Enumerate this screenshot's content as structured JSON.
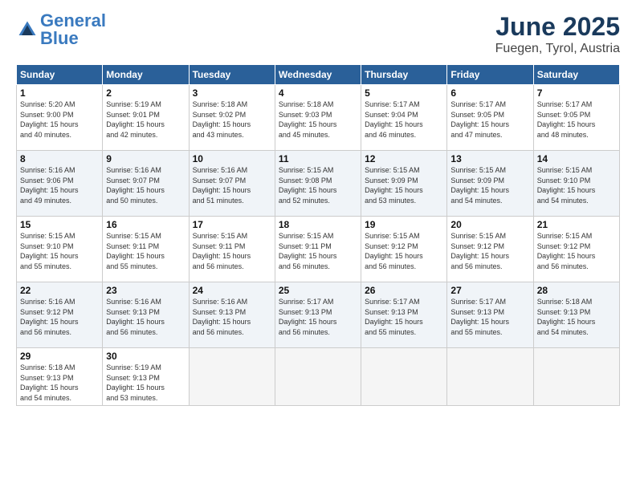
{
  "header": {
    "logo_general": "General",
    "logo_blue": "Blue",
    "month": "June 2025",
    "location": "Fuegen, Tyrol, Austria"
  },
  "weekdays": [
    "Sunday",
    "Monday",
    "Tuesday",
    "Wednesday",
    "Thursday",
    "Friday",
    "Saturday"
  ],
  "weeks": [
    [
      {
        "day": "1",
        "info": "Sunrise: 5:20 AM\nSunset: 9:00 PM\nDaylight: 15 hours\nand 40 minutes."
      },
      {
        "day": "2",
        "info": "Sunrise: 5:19 AM\nSunset: 9:01 PM\nDaylight: 15 hours\nand 42 minutes."
      },
      {
        "day": "3",
        "info": "Sunrise: 5:18 AM\nSunset: 9:02 PM\nDaylight: 15 hours\nand 43 minutes."
      },
      {
        "day": "4",
        "info": "Sunrise: 5:18 AM\nSunset: 9:03 PM\nDaylight: 15 hours\nand 45 minutes."
      },
      {
        "day": "5",
        "info": "Sunrise: 5:17 AM\nSunset: 9:04 PM\nDaylight: 15 hours\nand 46 minutes."
      },
      {
        "day": "6",
        "info": "Sunrise: 5:17 AM\nSunset: 9:05 PM\nDaylight: 15 hours\nand 47 minutes."
      },
      {
        "day": "7",
        "info": "Sunrise: 5:17 AM\nSunset: 9:05 PM\nDaylight: 15 hours\nand 48 minutes."
      }
    ],
    [
      {
        "day": "8",
        "info": "Sunrise: 5:16 AM\nSunset: 9:06 PM\nDaylight: 15 hours\nand 49 minutes."
      },
      {
        "day": "9",
        "info": "Sunrise: 5:16 AM\nSunset: 9:07 PM\nDaylight: 15 hours\nand 50 minutes."
      },
      {
        "day": "10",
        "info": "Sunrise: 5:16 AM\nSunset: 9:07 PM\nDaylight: 15 hours\nand 51 minutes."
      },
      {
        "day": "11",
        "info": "Sunrise: 5:15 AM\nSunset: 9:08 PM\nDaylight: 15 hours\nand 52 minutes."
      },
      {
        "day": "12",
        "info": "Sunrise: 5:15 AM\nSunset: 9:09 PM\nDaylight: 15 hours\nand 53 minutes."
      },
      {
        "day": "13",
        "info": "Sunrise: 5:15 AM\nSunset: 9:09 PM\nDaylight: 15 hours\nand 54 minutes."
      },
      {
        "day": "14",
        "info": "Sunrise: 5:15 AM\nSunset: 9:10 PM\nDaylight: 15 hours\nand 54 minutes."
      }
    ],
    [
      {
        "day": "15",
        "info": "Sunrise: 5:15 AM\nSunset: 9:10 PM\nDaylight: 15 hours\nand 55 minutes."
      },
      {
        "day": "16",
        "info": "Sunrise: 5:15 AM\nSunset: 9:11 PM\nDaylight: 15 hours\nand 55 minutes."
      },
      {
        "day": "17",
        "info": "Sunrise: 5:15 AM\nSunset: 9:11 PM\nDaylight: 15 hours\nand 56 minutes."
      },
      {
        "day": "18",
        "info": "Sunrise: 5:15 AM\nSunset: 9:11 PM\nDaylight: 15 hours\nand 56 minutes."
      },
      {
        "day": "19",
        "info": "Sunrise: 5:15 AM\nSunset: 9:12 PM\nDaylight: 15 hours\nand 56 minutes."
      },
      {
        "day": "20",
        "info": "Sunrise: 5:15 AM\nSunset: 9:12 PM\nDaylight: 15 hours\nand 56 minutes."
      },
      {
        "day": "21",
        "info": "Sunrise: 5:15 AM\nSunset: 9:12 PM\nDaylight: 15 hours\nand 56 minutes."
      }
    ],
    [
      {
        "day": "22",
        "info": "Sunrise: 5:16 AM\nSunset: 9:12 PM\nDaylight: 15 hours\nand 56 minutes."
      },
      {
        "day": "23",
        "info": "Sunrise: 5:16 AM\nSunset: 9:13 PM\nDaylight: 15 hours\nand 56 minutes."
      },
      {
        "day": "24",
        "info": "Sunrise: 5:16 AM\nSunset: 9:13 PM\nDaylight: 15 hours\nand 56 minutes."
      },
      {
        "day": "25",
        "info": "Sunrise: 5:17 AM\nSunset: 9:13 PM\nDaylight: 15 hours\nand 56 minutes."
      },
      {
        "day": "26",
        "info": "Sunrise: 5:17 AM\nSunset: 9:13 PM\nDaylight: 15 hours\nand 55 minutes."
      },
      {
        "day": "27",
        "info": "Sunrise: 5:17 AM\nSunset: 9:13 PM\nDaylight: 15 hours\nand 55 minutes."
      },
      {
        "day": "28",
        "info": "Sunrise: 5:18 AM\nSunset: 9:13 PM\nDaylight: 15 hours\nand 54 minutes."
      }
    ],
    [
      {
        "day": "29",
        "info": "Sunrise: 5:18 AM\nSunset: 9:13 PM\nDaylight: 15 hours\nand 54 minutes."
      },
      {
        "day": "30",
        "info": "Sunrise: 5:19 AM\nSunset: 9:13 PM\nDaylight: 15 hours\nand 53 minutes."
      },
      {
        "day": "",
        "info": ""
      },
      {
        "day": "",
        "info": ""
      },
      {
        "day": "",
        "info": ""
      },
      {
        "day": "",
        "info": ""
      },
      {
        "day": "",
        "info": ""
      }
    ]
  ]
}
